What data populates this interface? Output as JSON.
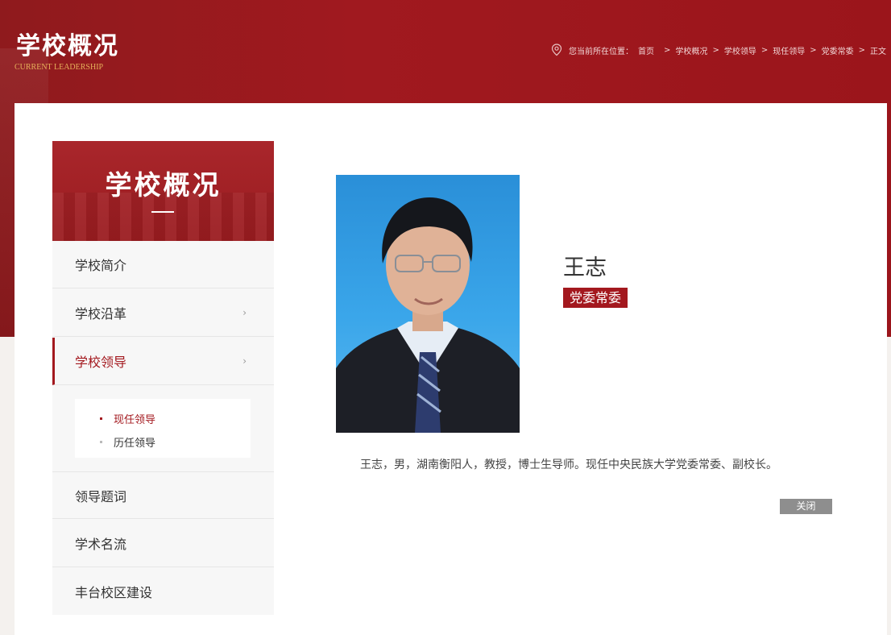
{
  "banner": {
    "title": "学校概况",
    "subtitle": "CURRENT LEADERSHIP"
  },
  "breadcrumb": {
    "icon": "location-pin-icon",
    "prefix": "您当前所在位置：",
    "items": [
      "首页",
      "学校概况",
      "学校领导",
      "现任领导",
      "党委常委",
      "正文"
    ],
    "separator": ">"
  },
  "sidebar": {
    "title": "学校概况",
    "items": [
      {
        "label": "学校简介"
      },
      {
        "label": "学校沿革",
        "arrow": "›"
      },
      {
        "label": "学校领导",
        "arrow": "›"
      },
      {
        "label": "领导题词"
      },
      {
        "label": "学术名流"
      },
      {
        "label": "丰台校区建设"
      }
    ],
    "submenu": [
      {
        "label": "现任领导"
      },
      {
        "label": "历任领导"
      }
    ]
  },
  "profile": {
    "name": "王志",
    "role": "党委常委",
    "bio": "王志，男，湖南衡阳人，教授，博士生导师。现任中央民族大学党委常委、副校长。",
    "close_label": "关闭"
  },
  "colors": {
    "brand_red": "#a3181e",
    "banner_red": "#9b151b",
    "accent_gold": "#e6b05a",
    "button_gray": "#8e8e8e"
  }
}
